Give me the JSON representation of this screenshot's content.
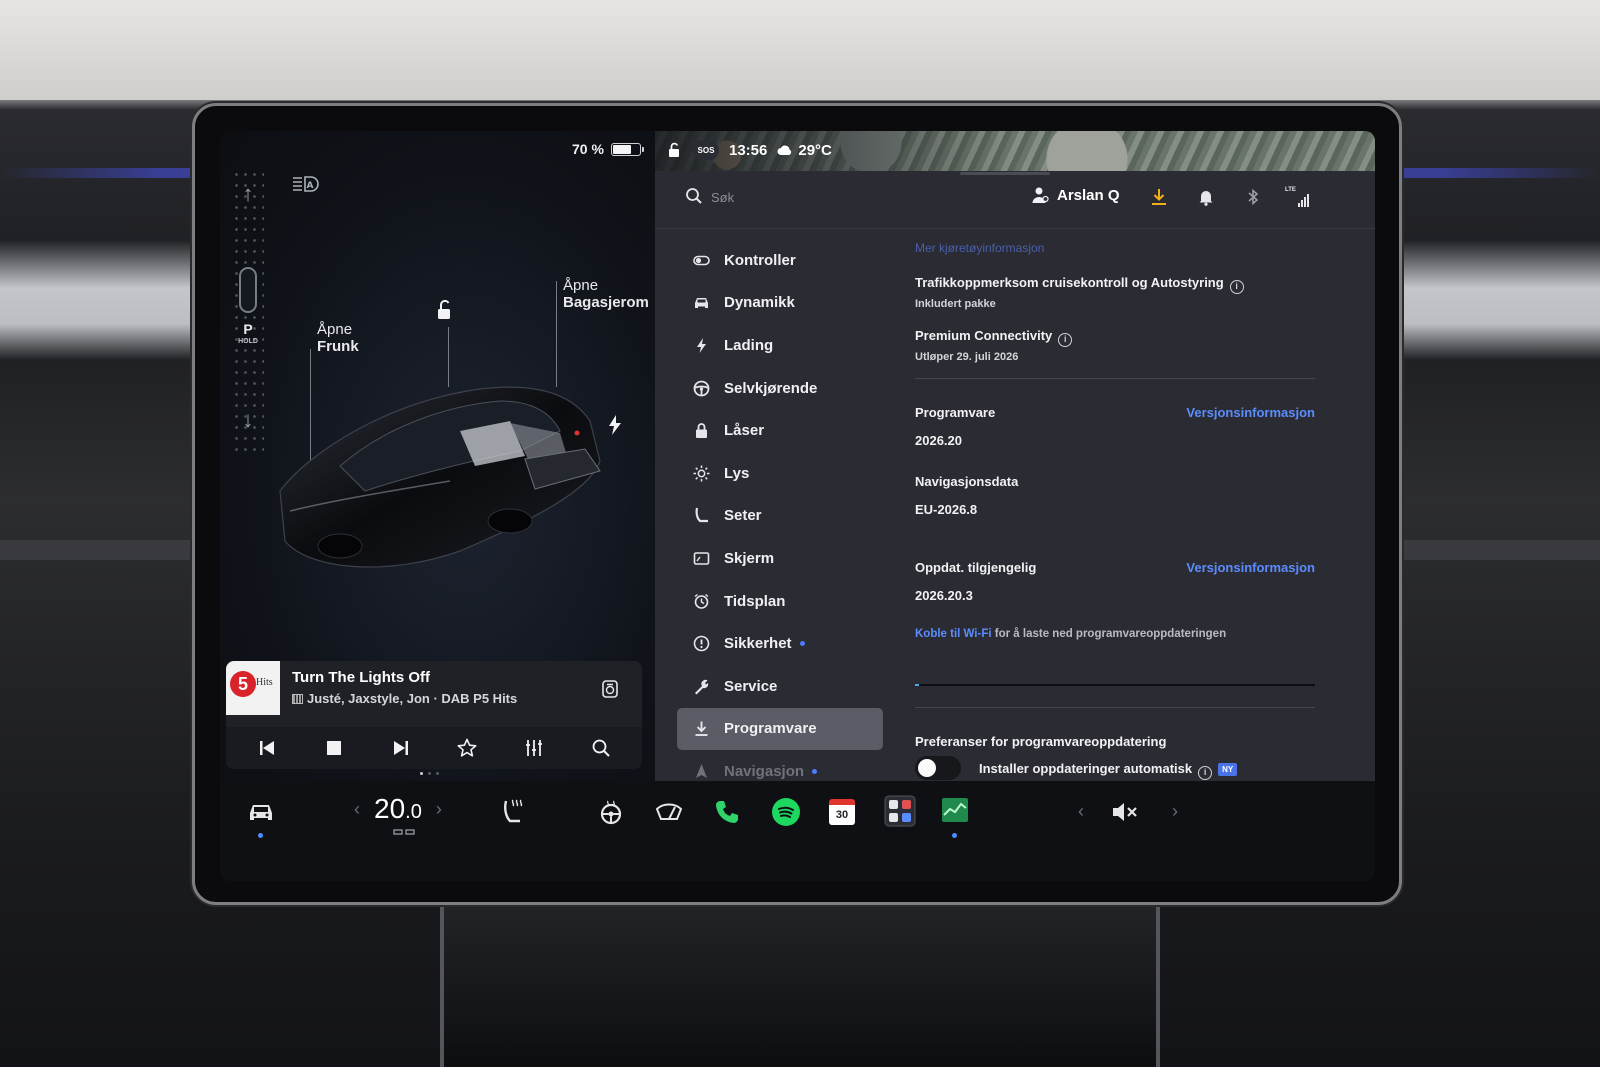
{
  "vehicle": {
    "battery_percent": "70 %",
    "battery_level": 0.7,
    "gear": "P",
    "gear_hold": "HOLD",
    "frunk_label_1": "Åpne",
    "frunk_label_2": "Frunk",
    "trunk_label_1": "Åpne",
    "trunk_label_2": "Bagasjerom"
  },
  "media": {
    "title": "Turn The Lights Off",
    "subtitle": "Justé, Jaxstyle, Jon · DAB P5 Hits",
    "art_logo_number": "5",
    "art_logo_text": "Hits"
  },
  "status": {
    "sos": "SOS",
    "time": "13:56",
    "temperature": "29°C"
  },
  "topbar": {
    "search_placeholder": "Søk",
    "user_name": "Arslan Q",
    "network": "LTE"
  },
  "menu": {
    "items": [
      {
        "label": "Kontroller",
        "icon": "toggle-icon"
      },
      {
        "label": "Dynamikk",
        "icon": "car-icon"
      },
      {
        "label": "Lading",
        "icon": "bolt-icon"
      },
      {
        "label": "Selvkjørende",
        "icon": "steering-wheel-icon"
      },
      {
        "label": "Låser",
        "icon": "lock-icon"
      },
      {
        "label": "Lys",
        "icon": "sun-icon"
      },
      {
        "label": "Seter",
        "icon": "seat-icon"
      },
      {
        "label": "Skjerm",
        "icon": "display-icon"
      },
      {
        "label": "Tidsplan",
        "icon": "clock-icon"
      },
      {
        "label": "Sikkerhet",
        "icon": "info-icon"
      },
      {
        "label": "Service",
        "icon": "wrench-icon"
      },
      {
        "label": "Programvare",
        "icon": "download-icon"
      },
      {
        "label": "Navigasjon",
        "icon": "navigation-icon"
      }
    ],
    "active_index": 11
  },
  "content": {
    "more_info_link": "Mer kjøretøyinformasjon",
    "feature_title": "Trafikkoppmerksom cruisekontroll og Autostyring",
    "feature_sub": "Inkludert pakke",
    "connectivity_title": "Premium Connectivity",
    "connectivity_sub": "Utløper 29. juli 2026",
    "software_label": "Programvare",
    "software_version": "2026.20",
    "release_notes_link_1": "Versjonsinformasjon",
    "nav_data_label": "Navigasjonsdata",
    "nav_data_version": "EU-2026.8",
    "update_label": "Oppdat. tilgjengelig",
    "update_version": "2026.20.3",
    "release_notes_link_2": "Versjonsinformasjon",
    "wifi_link": "Koble til Wi-Fi",
    "wifi_text": "for å laste ned programvareoppdateringen",
    "update_progress": 0.01,
    "prefs_title": "Preferanser for programvareoppdatering",
    "auto_install_label": "Installer oppdateringer automatisk",
    "auto_install_enabled": false,
    "new_badge": "NY"
  },
  "dock": {
    "cabin_temp": "20",
    "cabin_temp_decimal": ".0",
    "calendar_day": "30"
  },
  "colors": {
    "accent_blue": "#5b8cff",
    "active_dot": "#4f8cff",
    "spotify_green": "#1ed760",
    "phone_green": "#2fd36a"
  }
}
